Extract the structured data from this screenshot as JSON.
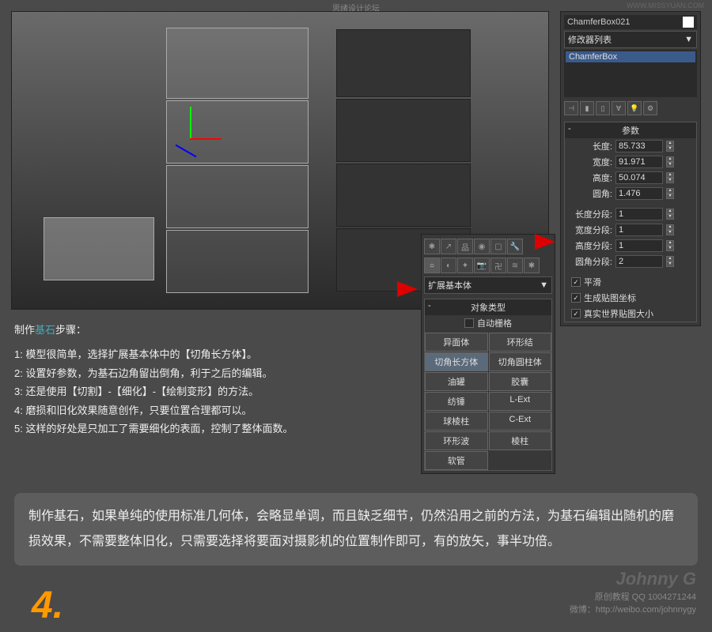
{
  "watermark": {
    "forum": "思绪设计论坛",
    "url": "WWW.MISSYUAN.COM"
  },
  "object_name": "ChamferBox021",
  "modifier_dropdown": "修改器列表",
  "modifier_stack": [
    "ChamferBox"
  ],
  "rollout_params": "参数",
  "params": {
    "length": {
      "label": "长度:",
      "value": "85.733"
    },
    "width": {
      "label": "宽度:",
      "value": "91.971"
    },
    "height": {
      "label": "高度:",
      "value": "50.074"
    },
    "fillet": {
      "label": "圆角:",
      "value": "1.476"
    },
    "length_segs": {
      "label": "长度分段:",
      "value": "1"
    },
    "width_segs": {
      "label": "宽度分段:",
      "value": "1"
    },
    "height_segs": {
      "label": "高度分段:",
      "value": "1"
    },
    "fillet_segs": {
      "label": "圆角分段:",
      "value": "2"
    }
  },
  "checks": {
    "smooth": "平滑",
    "gen_coords": "生成贴图坐标",
    "real_world": "真实世界贴图大小"
  },
  "create_panel": {
    "dropdown": "扩展基本体",
    "rollout": "对象类型",
    "autogrid": "自动栅格",
    "buttons": [
      "异面体",
      "环形结",
      "切角长方体",
      "切角圆柱体",
      "油罐",
      "胶囊",
      "纺锤",
      "L-Ext",
      "球棱柱",
      "C-Ext",
      "环形波",
      "棱柱",
      "软管",
      ""
    ]
  },
  "instructions": {
    "title_pre": "制作",
    "title_hl": "基石",
    "title_post": "步骤：",
    "lines": [
      "1: 模型很简单，选择扩展基本体中的【切角长方体】。",
      "2: 设置好参数，为基石边角留出倒角，利于之后的编辑。",
      "3: 还是使用【切割】-【细化】-【绘制变形】的方法。",
      "4: 磨损和旧化效果随意创作，只要位置合理都可以。",
      "5: 这样的好处是只加工了需要细化的表面，控制了整体面数。"
    ]
  },
  "summary": "制作基石，如果单纯的使用标准几何体，会略显单调，而且缺乏细节，仍然沿用之前的方法，为基石编辑出随机的磨损效果，不需要整体旧化，只需要选择将要面对摄影机的位置制作即可，有的放矢，事半功倍。",
  "step": "4.",
  "signature": {
    "name": "Johnny G",
    "line1": "原创教程 QQ 1004271244",
    "line2": "微博：http://weibo.com/johnnygy"
  }
}
